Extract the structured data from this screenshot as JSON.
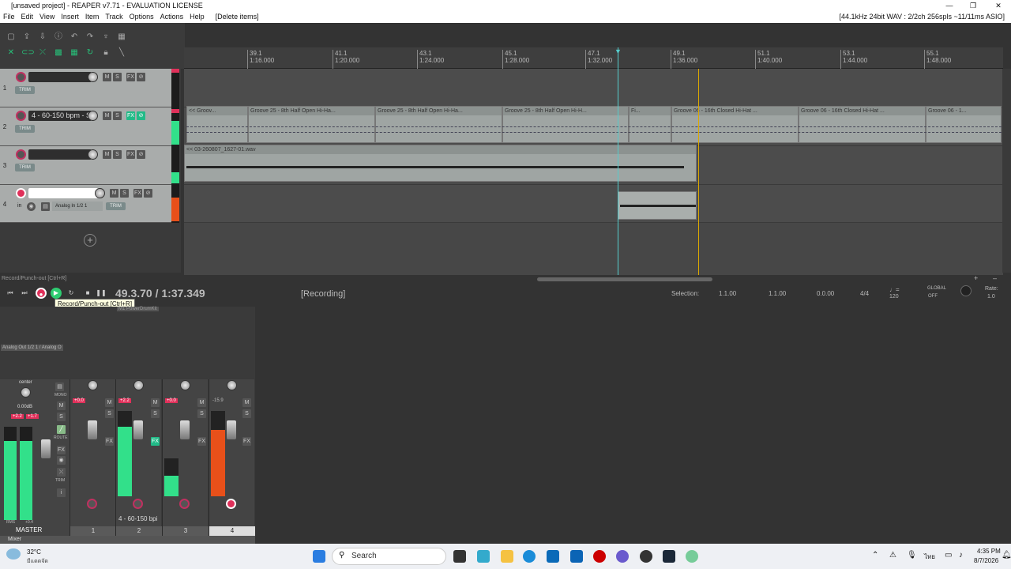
{
  "window": {
    "title": "[unsaved project] - REAPER v7.71 - EVALUATION LICENSE",
    "audio_status": "[44.1kHz 24bit WAV : 2/2ch 256spls ~11/11ms ASIO]"
  },
  "menu": [
    "File",
    "Edit",
    "View",
    "Insert",
    "Item",
    "Track",
    "Options",
    "Actions",
    "Help",
    "[Delete items]"
  ],
  "ruler": [
    {
      "bar": "39.1",
      "time": "1:16.000"
    },
    {
      "bar": "41.1",
      "time": "1:20.000"
    },
    {
      "bar": "43.1",
      "time": "1:24.000"
    },
    {
      "bar": "45.1",
      "time": "1:28.000"
    },
    {
      "bar": "47.1",
      "time": "1:32.000"
    },
    {
      "bar": "49.1",
      "time": "1:36.000"
    },
    {
      "bar": "51.1",
      "time": "1:40.000"
    },
    {
      "bar": "53.1",
      "time": "1:44.000"
    },
    {
      "bar": "55.1",
      "time": "1:48.000"
    }
  ],
  "tracks": [
    {
      "num": "1",
      "name": "",
      "fx": "FX",
      "trim": "TRIM"
    },
    {
      "num": "2",
      "name": "4 - 60-150 bpm - S",
      "fx": "FX",
      "trim": "TRIM"
    },
    {
      "num": "3",
      "name": "",
      "fx": "FX",
      "trim": "TRIM"
    },
    {
      "num": "4",
      "name": "",
      "fx": "FX",
      "trim": "TRIM",
      "input": "in",
      "input_name": "Analog In 1/2 1"
    }
  ],
  "items": {
    "groove": [
      "<< Groov...",
      "Groove 25 - 8th Half Open Hi-Ha...",
      "Groove 25 - 8th Half Open Hi-Ha...",
      "Groove 25 - 8th Half Open Hi-H...",
      "Fi...",
      "Groove 06 - 16th Closed Hi-Hat ...",
      "Groove 06 - 16th Closed Hi-Hat ...",
      "Groove 06 - 1..."
    ],
    "audio": "<< 03-260807_1627-01.wav"
  },
  "status_hint": "Record/Punch-out [Ctrl+R]",
  "transport": {
    "position": "49.3.70 / 1:37.349",
    "state": "[Recording]",
    "tooltip": "Record/Punch-out [Ctrl+R]"
  },
  "selection": {
    "label": "Selection:",
    "start": "1.1.00",
    "end": "1.1.00",
    "length": "0.0.00"
  },
  "timesig": "4/4",
  "tempo": "120",
  "global": {
    "label": "GLOBAL",
    "state": "OFF"
  },
  "rate": {
    "label": "Rate:",
    "value": "1.0"
  },
  "mixer": {
    "master": {
      "label": "MASTER",
      "pan": "center",
      "vol": "0.00dB",
      "peak_l": "+2.2",
      "peak_r": "+1.7",
      "output": "Analog Out 1/2 1 / Analog O",
      "rms": "RMS",
      "rms_val": "+0.4",
      "mono": "MONO",
      "route": "ROUTE",
      "fx": "FX",
      "trim": "TRIM"
    },
    "strips": [
      {
        "num": "1",
        "peak": "+0.0"
      },
      {
        "num": "2",
        "peak": "+2.2",
        "fxname": "M1 PowerDrumKit"
      },
      {
        "num": "3",
        "peak": "+0.0"
      },
      {
        "num": "4",
        "peak": "-15.9"
      }
    ],
    "strip_name": "4 - 60-150 bpi",
    "mixer_tab": "Mixer"
  },
  "taskbar": {
    "weather_temp": "32°C",
    "weather_desc": "มีแดดจัด",
    "search": "Search",
    "lang": "ไทย",
    "time": "4:35 PM",
    "date": "8/7/2026"
  }
}
